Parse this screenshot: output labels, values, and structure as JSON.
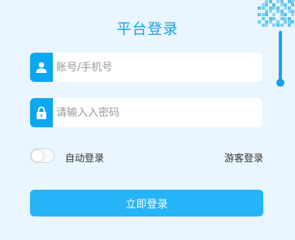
{
  "login": {
    "title": "平台登录",
    "account_placeholder": "账号/手机号",
    "password_placeholder": "请输入入密码",
    "auto_login_label": "自动登录",
    "guest_login_label": "游客登录",
    "submit_label": "立即登录",
    "auto_login_enabled": false
  },
  "icons": {
    "account": "user-icon",
    "password": "lock-icon",
    "corner": "qr-code-icon"
  },
  "colors": {
    "background": "#e9f6ff",
    "accent": "#1aa0e6",
    "icon_block": "#0aa8f2",
    "button": "#25b4f7",
    "field": "#ffffff"
  }
}
